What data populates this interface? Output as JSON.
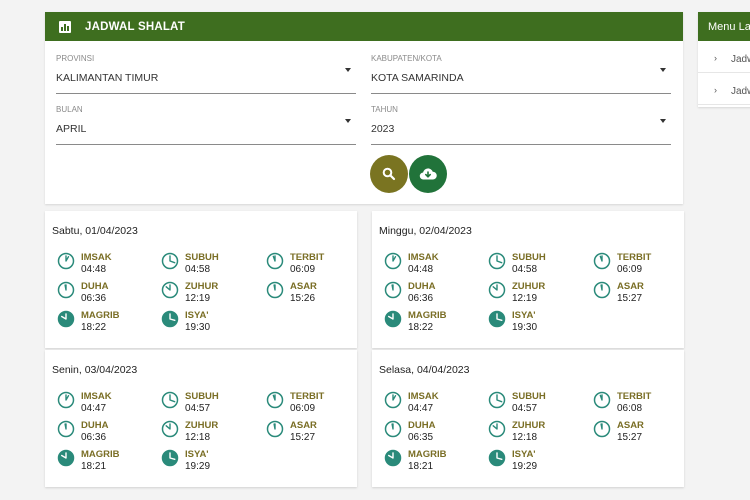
{
  "header": {
    "title": "JADWAL SHALAT",
    "icon": "chart-icon"
  },
  "filters": {
    "provinsi": {
      "label": "PROVINSI",
      "value": "KALIMANTAN TIMUR"
    },
    "kabupaten": {
      "label": "KABUPATEN/KOTA",
      "value": "KOTA SAMARINDA"
    },
    "bulan": {
      "label": "BULAN",
      "value": "APRIL"
    },
    "tahun": {
      "label": "TAHUN",
      "value": "2023"
    }
  },
  "buttons": {
    "search_icon": "search-icon",
    "download_icon": "cloud-download-icon"
  },
  "side": {
    "title": "Menu Lainnya",
    "items": [
      {
        "label": "Jadwal Imsakiyah"
      },
      {
        "label": "Jadwal Shalat"
      }
    ]
  },
  "colors": {
    "header_green": "#3e6e1f",
    "prayer_name": "#7a6e25",
    "icon_teal": "#2a8a7a",
    "search_button": "#7a7421",
    "download_button": "#21733a"
  },
  "days": [
    {
      "date": "Sabtu, 01/04/2023",
      "prayers": [
        {
          "name": "IMSAK",
          "time": "04:48",
          "icon": "clock-icon"
        },
        {
          "name": "SUBUH",
          "time": "04:58",
          "icon": "clock-icon"
        },
        {
          "name": "TERBIT",
          "time": "06:09",
          "icon": "clock-icon"
        },
        {
          "name": "DUHA",
          "time": "06:36",
          "icon": "clock-icon"
        },
        {
          "name": "ZUHUR",
          "time": "12:19",
          "icon": "clock-icon"
        },
        {
          "name": "ASAR",
          "time": "15:26",
          "icon": "clock-icon"
        },
        {
          "name": "MAGRIB",
          "time": "18:22",
          "icon": "clock-filled-icon"
        },
        {
          "name": "ISYA'",
          "time": "19:30",
          "icon": "clock-filled-icon"
        }
      ]
    },
    {
      "date": "Minggu, 02/04/2023",
      "prayers": [
        {
          "name": "IMSAK",
          "time": "04:48",
          "icon": "clock-icon"
        },
        {
          "name": "SUBUH",
          "time": "04:58",
          "icon": "clock-icon"
        },
        {
          "name": "TERBIT",
          "time": "06:09",
          "icon": "clock-icon"
        },
        {
          "name": "DUHA",
          "time": "06:36",
          "icon": "clock-icon"
        },
        {
          "name": "ZUHUR",
          "time": "12:19",
          "icon": "clock-icon"
        },
        {
          "name": "ASAR",
          "time": "15:27",
          "icon": "clock-icon"
        },
        {
          "name": "MAGRIB",
          "time": "18:22",
          "icon": "clock-filled-icon"
        },
        {
          "name": "ISYA'",
          "time": "19:30",
          "icon": "clock-filled-icon"
        }
      ]
    },
    {
      "date": "Senin, 03/04/2023",
      "prayers": [
        {
          "name": "IMSAK",
          "time": "04:47",
          "icon": "clock-icon"
        },
        {
          "name": "SUBUH",
          "time": "04:57",
          "icon": "clock-icon"
        },
        {
          "name": "TERBIT",
          "time": "06:09",
          "icon": "clock-icon"
        },
        {
          "name": "DUHA",
          "time": "06:36",
          "icon": "clock-icon"
        },
        {
          "name": "ZUHUR",
          "time": "12:18",
          "icon": "clock-icon"
        },
        {
          "name": "ASAR",
          "time": "15:27",
          "icon": "clock-icon"
        },
        {
          "name": "MAGRIB",
          "time": "18:21",
          "icon": "clock-filled-icon"
        },
        {
          "name": "ISYA'",
          "time": "19:29",
          "icon": "clock-filled-icon"
        }
      ]
    },
    {
      "date": "Selasa, 04/04/2023",
      "prayers": [
        {
          "name": "IMSAK",
          "time": "04:47",
          "icon": "clock-icon"
        },
        {
          "name": "SUBUH",
          "time": "04:57",
          "icon": "clock-icon"
        },
        {
          "name": "TERBIT",
          "time": "06:08",
          "icon": "clock-icon"
        },
        {
          "name": "DUHA",
          "time": "06:35",
          "icon": "clock-icon"
        },
        {
          "name": "ZUHUR",
          "time": "12:18",
          "icon": "clock-icon"
        },
        {
          "name": "ASAR",
          "time": "15:27",
          "icon": "clock-icon"
        },
        {
          "name": "MAGRIB",
          "time": "18:21",
          "icon": "clock-filled-icon"
        },
        {
          "name": "ISYA'",
          "time": "19:29",
          "icon": "clock-filled-icon"
        }
      ]
    }
  ]
}
